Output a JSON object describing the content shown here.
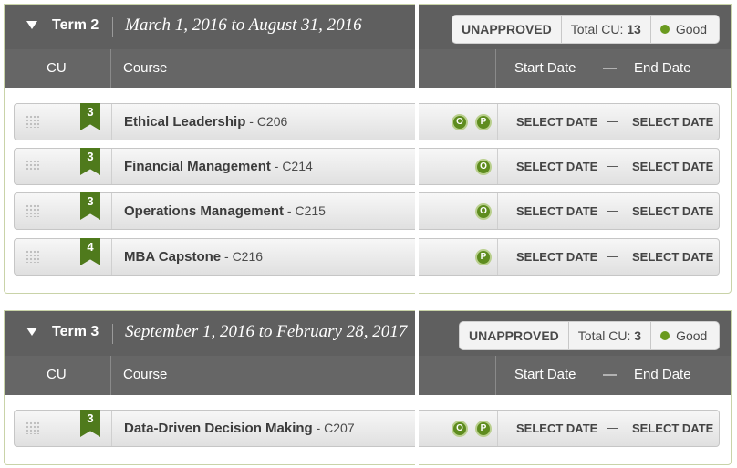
{
  "terms": [
    {
      "name": "Term 2",
      "dates": "March 1, 2016 to August 31, 2016",
      "status": "UNAPPROVED",
      "total_cu_label": "Total CU:",
      "total_cu": "13",
      "health": "Good",
      "columns": {
        "cu": "CU",
        "course": "Course",
        "start": "Start Date",
        "dash": "—",
        "end": "End Date"
      },
      "courses": [
        {
          "cu": "3",
          "title": "Ethical Leadership",
          "code": " - C206",
          "flags": [
            "O",
            "P"
          ],
          "start": "SELECT DATE",
          "dash": "—",
          "end": "SELECT DATE"
        },
        {
          "cu": "3",
          "title": "Financial Management",
          "code": " - C214",
          "flags": [
            "O"
          ],
          "start": "SELECT DATE",
          "dash": "—",
          "end": "SELECT DATE"
        },
        {
          "cu": "3",
          "title": "Operations Management",
          "code": " - C215",
          "flags": [
            "O"
          ],
          "start": "SELECT DATE",
          "dash": "—",
          "end": "SELECT DATE"
        },
        {
          "cu": "4",
          "title": "MBA Capstone",
          "code": " - C216",
          "flags": [
            "P"
          ],
          "start": "SELECT DATE",
          "dash": "—",
          "end": "SELECT DATE"
        }
      ]
    },
    {
      "name": "Term 3",
      "dates": "September 1, 2016 to February 28, 2017",
      "status": "UNAPPROVED",
      "total_cu_label": "Total CU:",
      "total_cu": "3",
      "health": "Good",
      "columns": {
        "cu": "CU",
        "course": "Course",
        "start": "Start Date",
        "dash": "—",
        "end": "End Date"
      },
      "courses": [
        {
          "cu": "3",
          "title": "Data-Driven Decision Making",
          "code": " - C207",
          "flags": [
            "O",
            "P"
          ],
          "start": "SELECT DATE",
          "dash": "—",
          "end": "SELECT DATE"
        }
      ]
    }
  ],
  "colors": {
    "accent_green": "#4f7a1c",
    "header_gray": "#5f5f5f",
    "good_dot": "#6a9a1f"
  },
  "icons": {
    "collapse": "triangle-down-icon",
    "drag": "drag-handle-icon",
    "cu_badge": "ribbon-icon"
  }
}
